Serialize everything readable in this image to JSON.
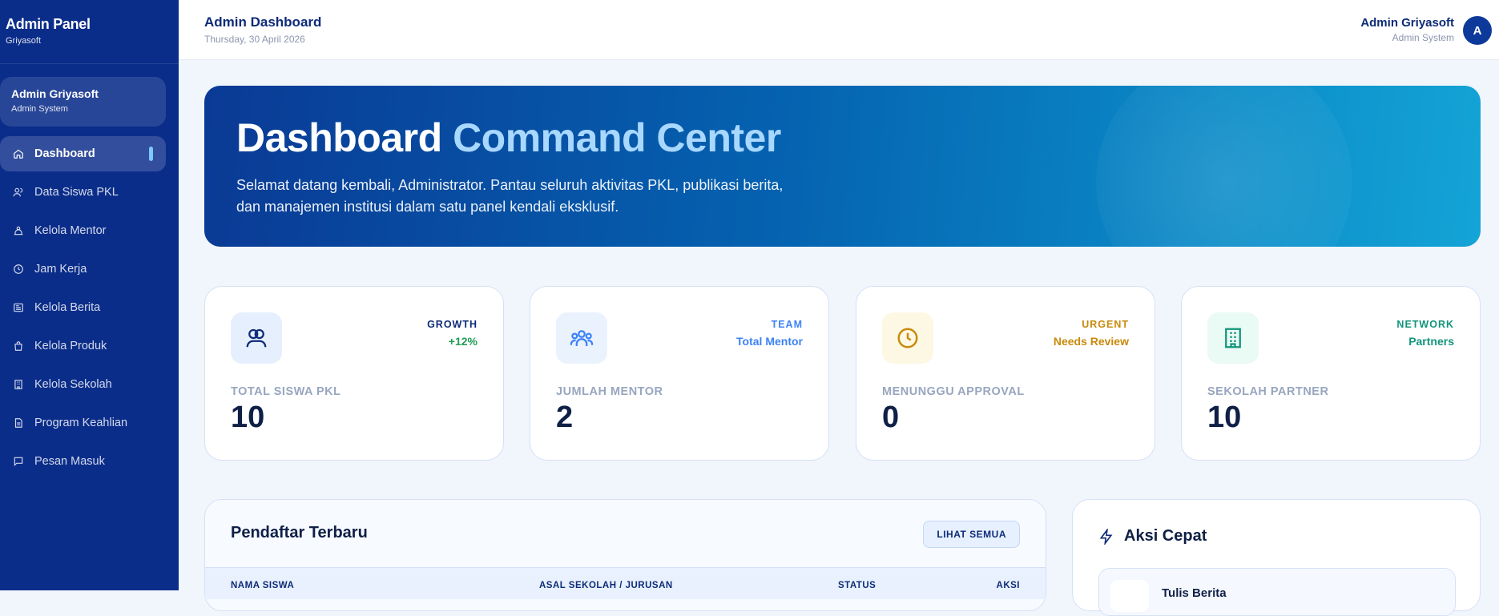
{
  "brand": {
    "title": "Admin Panel",
    "subtitle": "Griyasoft"
  },
  "sidebar_user": {
    "name": "Admin Griyasoft",
    "role": "Admin System"
  },
  "nav": [
    {
      "label": "Dashboard",
      "icon": "home-icon",
      "active": true
    },
    {
      "label": "Data Siswa PKL",
      "icon": "users-icon"
    },
    {
      "label": "Kelola Mentor",
      "icon": "mentor-icon"
    },
    {
      "label": "Jam Kerja",
      "icon": "clock-icon"
    },
    {
      "label": "Kelola Berita",
      "icon": "newspaper-icon"
    },
    {
      "label": "Kelola Produk",
      "icon": "bag-icon"
    },
    {
      "label": "Kelola Sekolah",
      "icon": "building-icon"
    },
    {
      "label": "Program Keahlian",
      "icon": "document-icon"
    },
    {
      "label": "Pesan Masuk",
      "icon": "message-icon"
    }
  ],
  "topbar": {
    "title": "Admin Dashboard",
    "date": "Thursday, 30 April 2026",
    "user_name": "Admin Griyasoft",
    "user_role": "Admin System",
    "avatar_initial": "A"
  },
  "hero": {
    "title_main": "Dashboard",
    "title_accent": "Command Center",
    "description": "Selamat datang kembali, Administrator. Pantau seluruh aktivitas PKL, publikasi berita, dan manajemen institusi dalam satu panel kendali eksklusif."
  },
  "stats": [
    {
      "tag": "GROWTH",
      "tag_value": "+12%",
      "label": "TOTAL SISWA PKL",
      "value": "10",
      "icon": "users-icon",
      "tag_color": "#0d2b78",
      "value_color": "#1f9d55",
      "icon_bg": "#e6effd",
      "icon_color": "#0d2b78"
    },
    {
      "tag": "TEAM",
      "tag_value": "Total Mentor",
      "label": "JUMLAH MENTOR",
      "value": "2",
      "icon": "team-icon",
      "tag_color": "#3b82f6",
      "value_color": "#3b82f6",
      "icon_bg": "#eaf2fe",
      "icon_color": "#3b82f6"
    },
    {
      "tag": "URGENT",
      "tag_value": "Needs Review",
      "label": "MENUNGGU APPROVAL",
      "value": "0",
      "icon": "clock-icon",
      "tag_color": "#c98a0c",
      "value_color": "#c98a0c",
      "icon_bg": "#fdf8e4",
      "icon_color": "#c98a0c"
    },
    {
      "tag": "NETWORK",
      "tag_value": "Partners",
      "label": "SEKOLAH PARTNER",
      "value": "10",
      "icon": "building-icon",
      "tag_color": "#11957a",
      "value_color": "#11957a",
      "icon_bg": "#eafaf5",
      "icon_color": "#11957a"
    }
  ],
  "recent": {
    "title": "Pendaftar Terbaru",
    "see_all": "LIHAT SEMUA",
    "columns": [
      "NAMA SISWA",
      "ASAL SEKOLAH / JURUSAN",
      "STATUS",
      "AKSI"
    ]
  },
  "quick_actions": {
    "title": "Aksi Cepat",
    "first_item": "Tulis Berita"
  }
}
